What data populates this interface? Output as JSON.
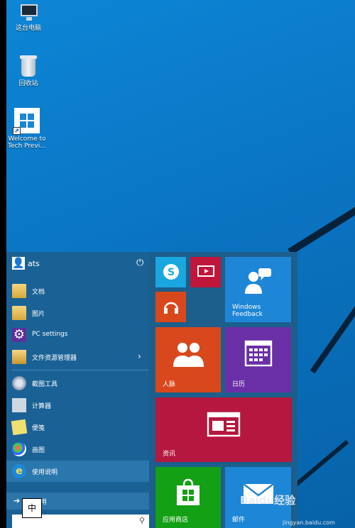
{
  "desktop": {
    "icons": [
      {
        "label": "这台电脑",
        "icon": "computer-icon"
      },
      {
        "label": "回收站",
        "icon": "recycle-bin-icon"
      },
      {
        "label_line1": "Welcome to",
        "label_line2": "Tech Previ...",
        "icon": "windows-logo-icon"
      }
    ]
  },
  "start_menu": {
    "user": {
      "name": "ats",
      "power_icon": "power-icon"
    },
    "items": [
      {
        "label": "文档",
        "icon": "folder-icon"
      },
      {
        "label": "图片",
        "icon": "folder-icon"
      },
      {
        "label": "PC settings",
        "icon": "gear-icon"
      },
      {
        "label": "文件资源管理器",
        "icon": "file-explorer-icon",
        "arrow": "›"
      }
    ],
    "recent": [
      {
        "label": "截图工具",
        "icon": "snipping-tool-icon"
      },
      {
        "label": "计算器",
        "icon": "calculator-icon"
      },
      {
        "label": "便笺",
        "icon": "sticky-notes-icon"
      },
      {
        "label": "画图",
        "icon": "paint-icon"
      },
      {
        "label": "使用说明",
        "icon": "internet-explorer-icon"
      }
    ],
    "all_apps": {
      "arrow": "➔",
      "label": "有应用"
    },
    "ime": "中",
    "search_icon": "⚲",
    "tiles": {
      "feedback_line1": "Windows",
      "feedback_line2": "Feedback",
      "people": "人脉",
      "calendar": "日历",
      "news": "资讯",
      "store": "应用商店",
      "mail": "邮件"
    }
  },
  "watermark": {
    "text": "Baidu经验",
    "url": "jingyan.baidu.com"
  },
  "colors": {
    "desktop_bg": "#0a78c8",
    "start_left": "#1a6296",
    "tile_skype": "#1aa7e0",
    "tile_red": "#c0163a",
    "tile_orange": "#d9481c",
    "tile_blue": "#1e86d6",
    "tile_purple": "#6a2fa6",
    "tile_green": "#14a014"
  }
}
